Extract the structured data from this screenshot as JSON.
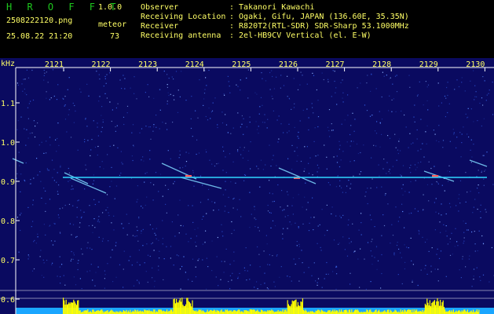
{
  "app": {
    "name": "H R O F F T",
    "version": "1.0.0"
  },
  "file": {
    "name": "2508222120.png",
    "datetime": "25.08.22 21:20"
  },
  "meteor": {
    "label": "meteor",
    "count": "73"
  },
  "station": [
    {
      "key": "Observer",
      "value": ": Takanori Kawachi"
    },
    {
      "key": "Receiving Location",
      "value": ": Ogaki, Gifu, JAPAN (136.60E, 35.35N)"
    },
    {
      "key": "Receiver",
      "value": ": R820T2(RTL-SDR) SDR-Sharp 53.1000MHz"
    },
    {
      "key": "Receiving antenna",
      "value": ": 2el-HB9CV Vertical (el. E-W)"
    }
  ],
  "spectrogram": {
    "yunit": "kHz",
    "xticks": [
      "2121",
      "2122",
      "2123",
      "2124",
      "2125",
      "2126",
      "2127",
      "2128",
      "2129",
      "2130"
    ],
    "yticks": [
      "1.1",
      "1.0",
      "0.9",
      "0.8",
      "0.7",
      "0.6"
    ],
    "carrier_khz": 0.91,
    "colors": {
      "background": "#0a0a60",
      "carrier": "#2fd6ff",
      "signal": "#ffff00",
      "axis": "#ffffff",
      "label": "#ffff66"
    }
  }
}
